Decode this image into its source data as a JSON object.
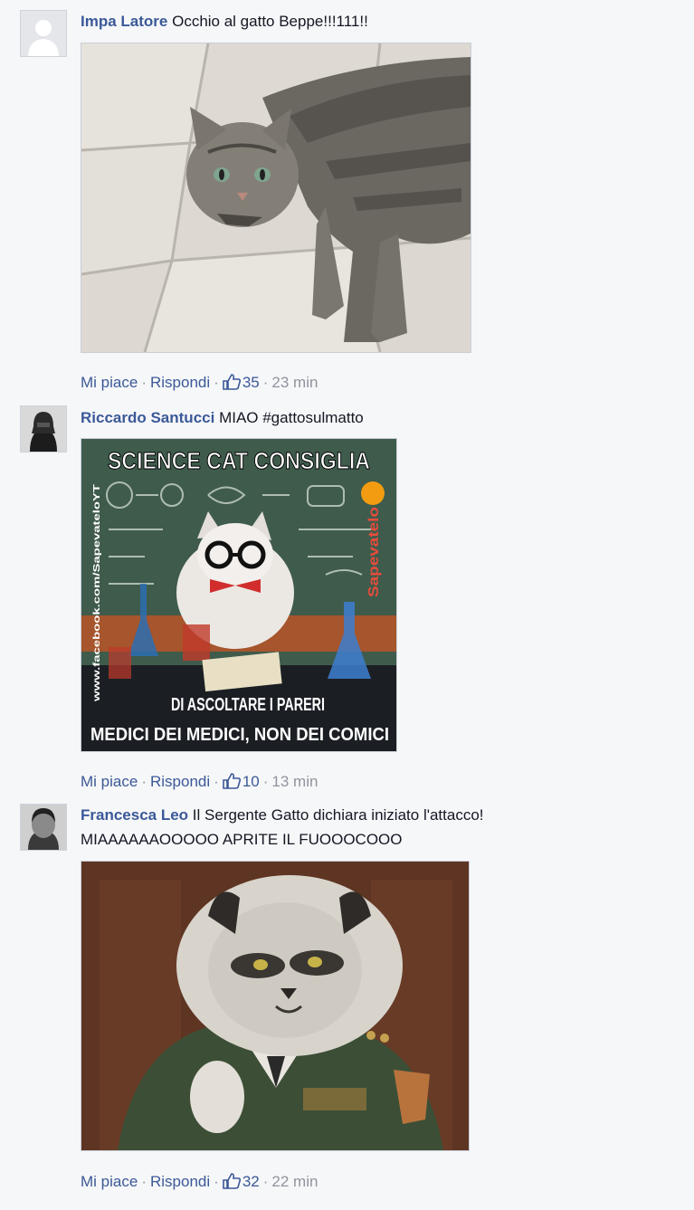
{
  "comments": [
    {
      "author": "Impa Latore",
      "text": "Occhio al gatto Beppe!!!111!!",
      "actions": {
        "like": "Mi piace",
        "reply": "Rispondi",
        "likes": "35",
        "time": "23 min"
      }
    },
    {
      "author": "Riccardo Santucci",
      "text": "MIAO #gattosulmatto",
      "image_text": {
        "title": "SCIENCE CAT CONSIGLIA",
        "line1": "DI ASCOLTARE I PARERI",
        "line2": "MEDICI DEI MEDICI, NON DEI COMICI",
        "side": "www.facebook.com/SapevateloYT",
        "brand": "Sapevatelo"
      },
      "actions": {
        "like": "Mi piace",
        "reply": "Rispondi",
        "likes": "10",
        "time": "13 min"
      }
    },
    {
      "author": "Francesca Leo",
      "text": "Il Sergente Gatto dichiara iniziato l'attacco!",
      "text2": "MIAAAAAAOOOOO APRITE IL FUOOOCOOO",
      "actions": {
        "like": "Mi piace",
        "reply": "Rispondi",
        "likes": "32",
        "time": "22 min"
      }
    }
  ],
  "icons": {
    "like": "thumbs-up-icon",
    "default_avatar": "person-silhouette-icon"
  },
  "colors": {
    "link": "#3b5998",
    "meta": "#90949c",
    "background": "#f6f7f9"
  }
}
